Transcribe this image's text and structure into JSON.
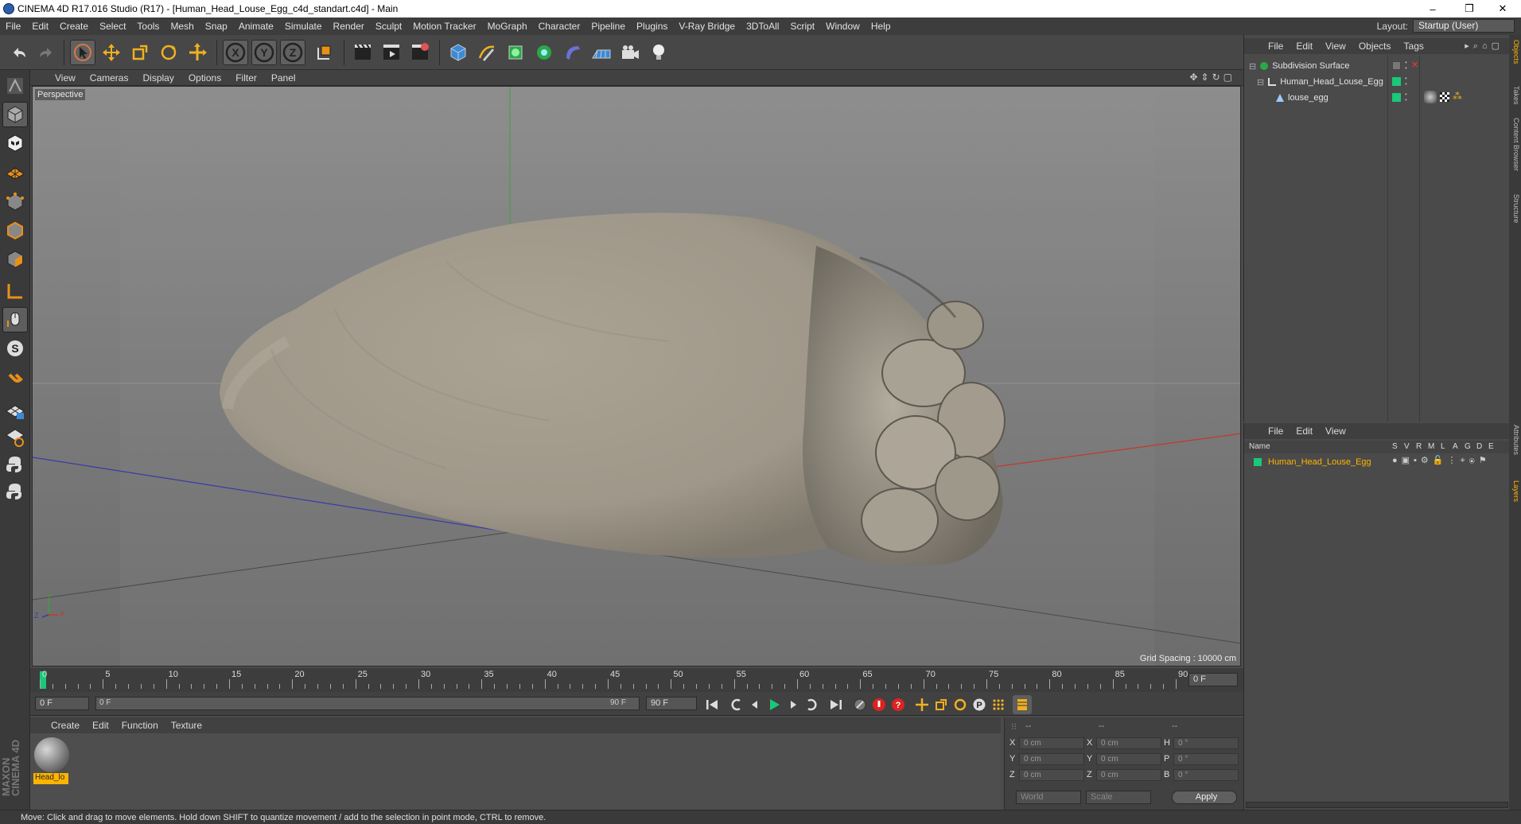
{
  "window": {
    "title": "CINEMA 4D R17.016 Studio (R17) - [Human_Head_Louse_Egg_c4d_standart.c4d] - Main",
    "minimize": "–",
    "maximize": "❐",
    "close": "✕"
  },
  "menubar": {
    "items": [
      "File",
      "Edit",
      "Create",
      "Select",
      "Tools",
      "Mesh",
      "Snap",
      "Animate",
      "Simulate",
      "Render",
      "Sculpt",
      "Motion Tracker",
      "MoGraph",
      "Character",
      "Pipeline",
      "Plugins",
      "V-Ray Bridge",
      "3DToAll",
      "Script",
      "Window",
      "Help"
    ],
    "layout_label": "Layout:",
    "layout_value": "Startup (User)"
  },
  "viewport": {
    "menu": [
      "View",
      "Cameras",
      "Display",
      "Options",
      "Filter",
      "Panel"
    ],
    "label": "Perspective",
    "grid_spacing": "Grid Spacing : 10000 cm",
    "axis_x": "X",
    "axis_y": "Y",
    "axis_z": "Z"
  },
  "timeline": {
    "ticks": [
      "0",
      "5",
      "10",
      "15",
      "20",
      "25",
      "30",
      "35",
      "40",
      "45",
      "50",
      "55",
      "60",
      "65",
      "70",
      "75",
      "80",
      "85",
      "90"
    ],
    "current_frame": "0 F",
    "start_frame": "0 F",
    "range_start": "0 F",
    "range_end": "90 F",
    "end_frame": "90 F"
  },
  "material_manager": {
    "menu": [
      "Create",
      "Edit",
      "Function",
      "Texture"
    ],
    "materials": [
      {
        "name": "Head_lo"
      }
    ]
  },
  "coordinates": {
    "header": [
      "--",
      "--",
      "--"
    ],
    "rows": [
      {
        "a": "X",
        "av": "0 cm",
        "b": "X",
        "bv": "0 cm",
        "c": "H",
        "cv": "0 °"
      },
      {
        "a": "Y",
        "av": "0 cm",
        "b": "Y",
        "bv": "0 cm",
        "c": "P",
        "cv": "0 °"
      },
      {
        "a": "Z",
        "av": "0 cm",
        "b": "Z",
        "bv": "0 cm",
        "c": "B",
        "cv": "0 °"
      }
    ],
    "world": "World",
    "scale": "Scale",
    "apply": "Apply"
  },
  "object_manager": {
    "menu": [
      "File",
      "Edit",
      "View",
      "Objects",
      "Tags"
    ],
    "objects": [
      {
        "name": "Subdivision Surface"
      },
      {
        "name": "Human_Head_Louse_Egg"
      },
      {
        "name": "louse_egg"
      }
    ]
  },
  "layer_manager": {
    "menu": [
      "File",
      "Edit",
      "View"
    ],
    "columns": [
      "Name",
      "S",
      "V",
      "R",
      "M",
      "L",
      "A",
      "G",
      "D",
      "E"
    ],
    "layers": [
      {
        "name": "Human_Head_Louse_Egg"
      }
    ]
  },
  "side_tabs": [
    "Objects",
    "Takes",
    "Content Browser",
    "Structure",
    "Attributes",
    "Layers"
  ],
  "status": "Move: Click and drag to move elements. Hold down SHIFT to quantize movement / add to the selection in point mode, CTRL to remove.",
  "brand": {
    "line1": "MAXON",
    "line2": "CINEMA 4D"
  },
  "colors": {
    "accent": "#ffb400",
    "layer_green": "#19c878",
    "x_axis": "#c23a2a",
    "y_axis": "#3da13d",
    "z_axis": "#3a3aa8"
  }
}
